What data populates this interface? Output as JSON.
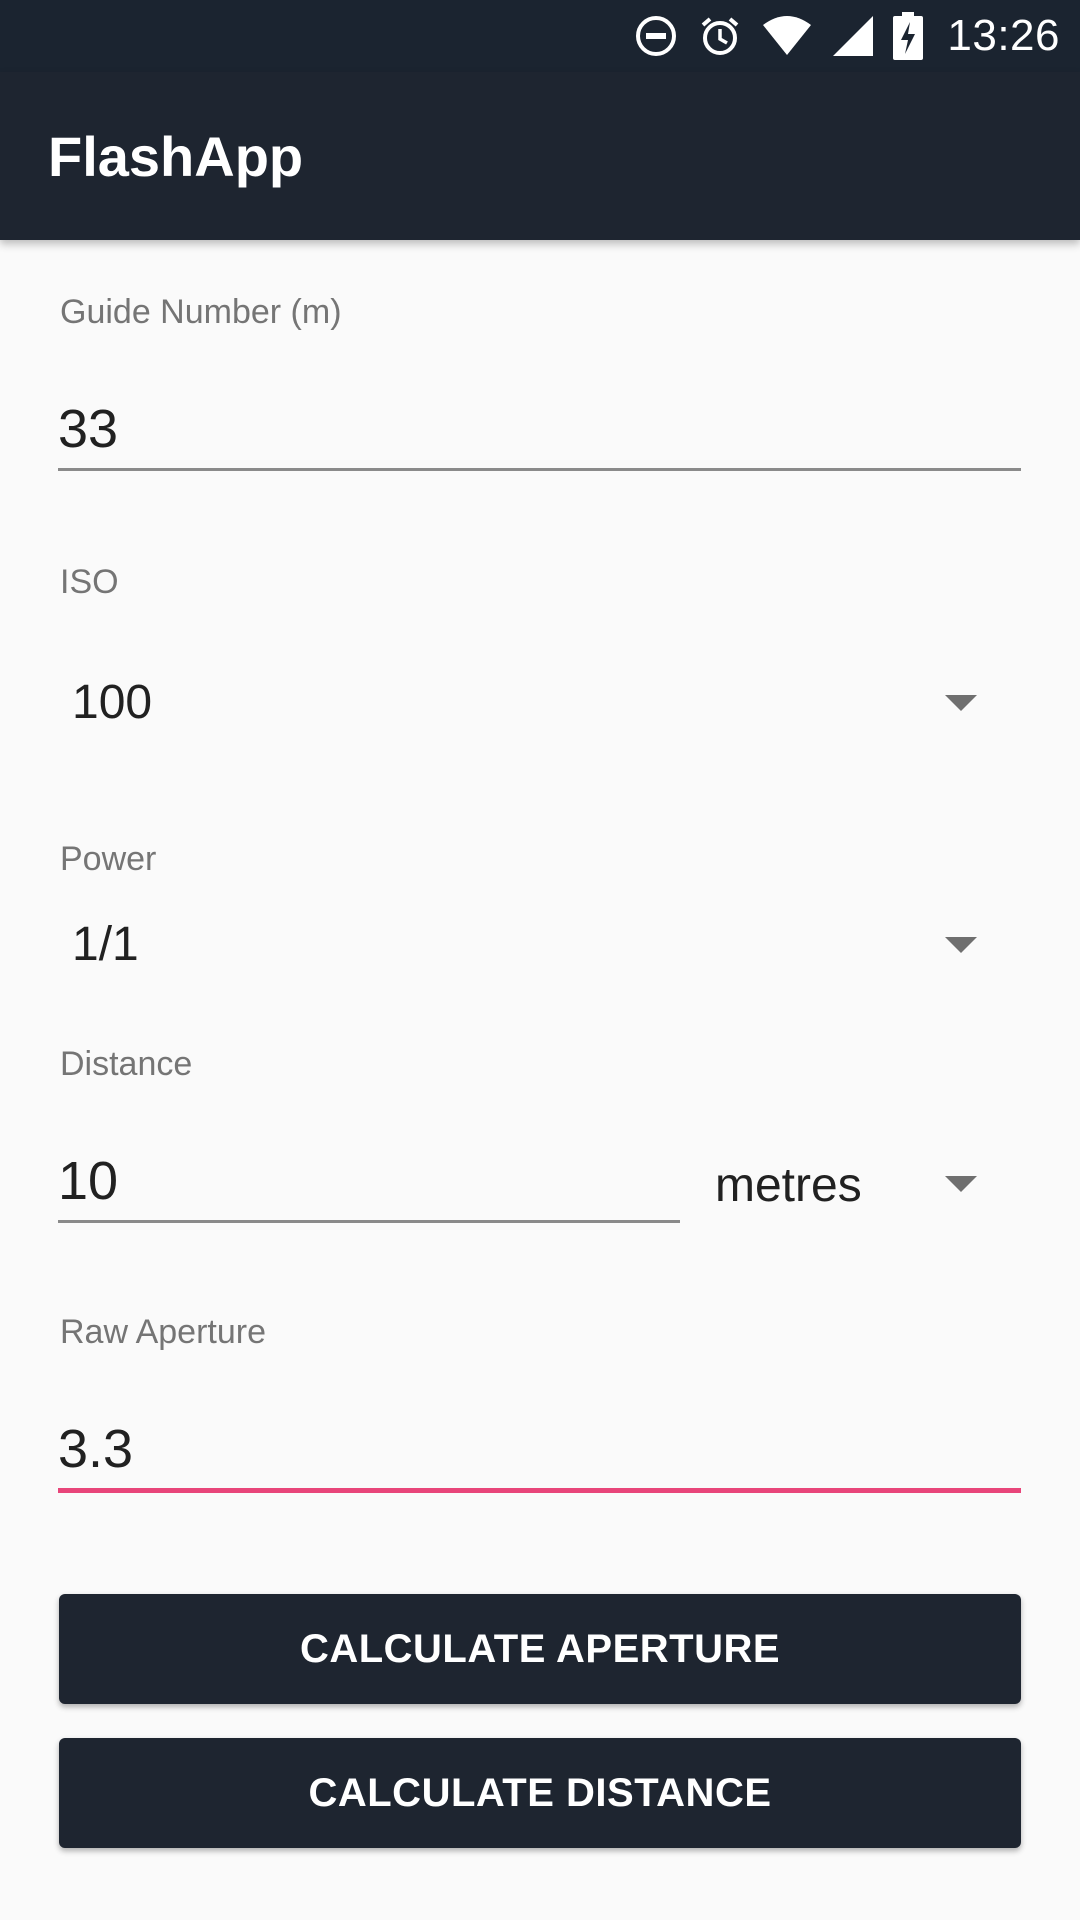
{
  "status_bar": {
    "time": "13:26",
    "icons": [
      "do-not-disturb-icon",
      "alarm-icon",
      "wifi-icon",
      "cell-signal-icon",
      "battery-charging-icon"
    ]
  },
  "app_bar": {
    "title": "FlashApp"
  },
  "form": {
    "guide_number": {
      "label": "Guide Number (m)",
      "value": "33"
    },
    "iso": {
      "label": "ISO",
      "selected": "100"
    },
    "power": {
      "label": "Power",
      "selected": "1/1"
    },
    "distance": {
      "label": "Distance",
      "value": "10",
      "unit_selected": "metres"
    },
    "raw_aperture": {
      "label": "Raw Aperture",
      "value": "3.3"
    }
  },
  "buttons": {
    "calculate_aperture": "CALCULATE APERTURE",
    "calculate_distance": "CALCULATE DISTANCE"
  },
  "colors": {
    "primary": "#1e2530",
    "accent": "#e8457a",
    "background": "#fafafa"
  }
}
